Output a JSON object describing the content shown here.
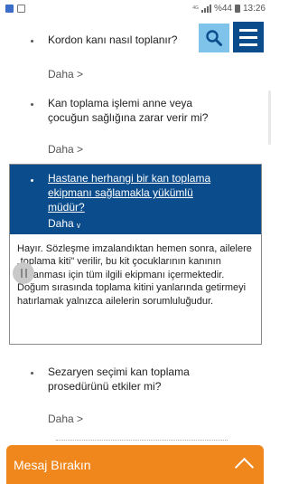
{
  "status_bar": {
    "signal_label": "4G",
    "battery": "%44",
    "time": "13:26"
  },
  "header": {
    "search_icon": "search-icon",
    "menu_icon": "hamburger-menu-icon",
    "colors": {
      "search_bg": "#7fc2ea",
      "menu_bg": "#0a4c8c"
    }
  },
  "faq": {
    "more_label": "Daha >",
    "items": [
      {
        "question": "Kordon kanı nasıl toplanır?"
      },
      {
        "question": "Kan toplama işlemi anne veya çocuğun sağlığına zarar verir mi?"
      },
      {
        "question": "Hastane herhangi bir kan toplama ekipmanı sağlamakla yükümlü müdür?",
        "more_label": "Daha ᵥ",
        "answer": "Hayır. Sözleşme imzalandıktan hemen sonra, ailelere „toplama kiti\" verilir, bu kit çocuklarının kanının toplanması için tüm ilgili ekipmanı içermektedir. Doğum sırasında toplama kitini yanlarında getirmeyi hatırlamak yalnızca ailelerin sorumluluğudur."
      },
      {
        "question": "Sezaryen seçimi kan toplama prosedürünü etkiler mi?"
      }
    ],
    "colors": {
      "expanded_bg": "#0a4c8c"
    }
  },
  "message_bar": {
    "label": "Mesaj Bırakın",
    "icon": "chevron-up-icon",
    "color": "#f0871d"
  }
}
